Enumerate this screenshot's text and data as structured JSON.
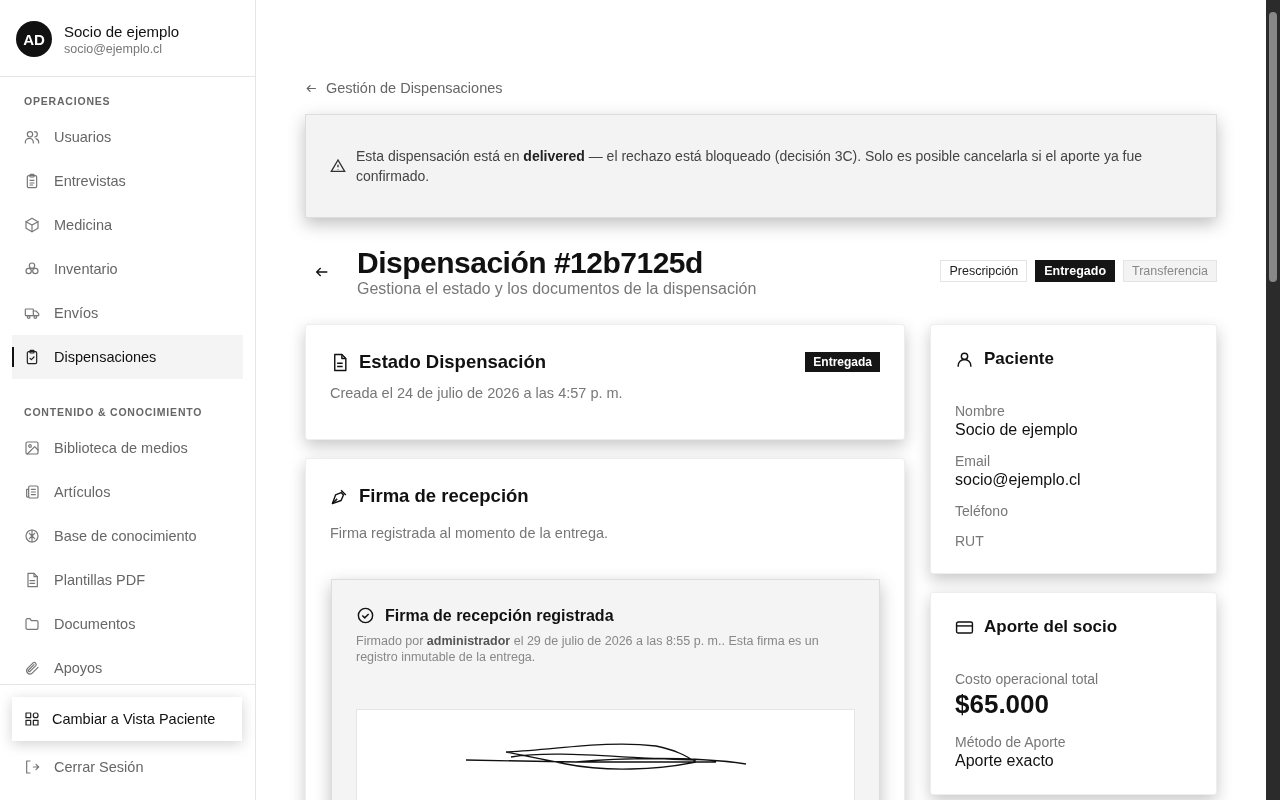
{
  "user": {
    "initials": "AD",
    "name": "Socio de ejemplo",
    "email": "socio@ejemplo.cl"
  },
  "sidebar": {
    "sections": [
      {
        "title": "OPERACIONES",
        "items": [
          {
            "label": "Usuarios",
            "kind": "users",
            "selected": false
          },
          {
            "label": "Entrevistas",
            "kind": "list",
            "selected": false
          },
          {
            "label": "Medicina",
            "kind": "box",
            "selected": false
          },
          {
            "label": "Inventario",
            "kind": "stock",
            "selected": false
          },
          {
            "label": "Envíos",
            "kind": "shipping",
            "selected": false
          },
          {
            "label": "Dispensaciones",
            "kind": "dispensing",
            "selected": true
          }
        ]
      },
      {
        "title": "CONTENIDO & CONOCIMIENTO",
        "items": [
          {
            "label": "Biblioteca de medios",
            "kind": "media",
            "selected": false
          },
          {
            "label": "Artículos",
            "kind": "articles",
            "selected": false
          },
          {
            "label": "Base de conocimiento",
            "kind": "knowledge",
            "selected": false
          },
          {
            "label": "Plantillas PDF",
            "kind": "template",
            "selected": false
          },
          {
            "label": "Documentos",
            "kind": "folder",
            "selected": false
          },
          {
            "label": "Apoyos",
            "kind": "support",
            "selected": false
          }
        ]
      }
    ],
    "switch_button": "Cambiar a Vista Paciente",
    "logout": "Cerrar Sesión"
  },
  "breadcrumb": "Gestión de Dispensaciones",
  "alert": "Esta dispensación está en **delivered** — el rechazo está bloqueado (decisión 3C). Solo es posible cancelarla si el aporte ya fue confirmado.",
  "header": {
    "title": "Dispensación #12b7125d",
    "subtitle": "Gestiona el estado y los documentos de la dispensación",
    "steps": [
      {
        "label": "Prescripción",
        "selected": false,
        "disabled": false
      },
      {
        "label": "Entregado",
        "selected": true,
        "disabled": false
      },
      {
        "label": "Transferencia",
        "selected": false,
        "disabled": true
      }
    ]
  },
  "status_card": {
    "title": "Estado Dispensación",
    "badge": "Entregada",
    "created": "Creada el 24 de julio de 2026 a las 4:57 p. m."
  },
  "signature_card": {
    "title": "Firma de recepción",
    "subtitle": "Firma registrada al momento de la entrega.",
    "panel": {
      "title": "Firma de recepción registrada",
      "text": "Firmado por **administrador** el 29 de julio de 2026 a las 8:55 p. m.. Esta firma es un registro inmutable de la entrega."
    }
  },
  "patient_card": {
    "title": "Paciente",
    "fields": [
      {
        "label": "Nombre",
        "value": "Socio de ejemplo"
      },
      {
        "label": "Email",
        "value": "socio@ejemplo.cl"
      },
      {
        "label": "Teléfono"
      },
      {
        "label": "RUT"
      }
    ]
  },
  "contribution_card": {
    "title": "Aporte del socio",
    "total_label": "Costo operacional total",
    "total": "$65.000",
    "method_label": "Método de Aporte",
    "method": "Aporte exacto"
  }
}
